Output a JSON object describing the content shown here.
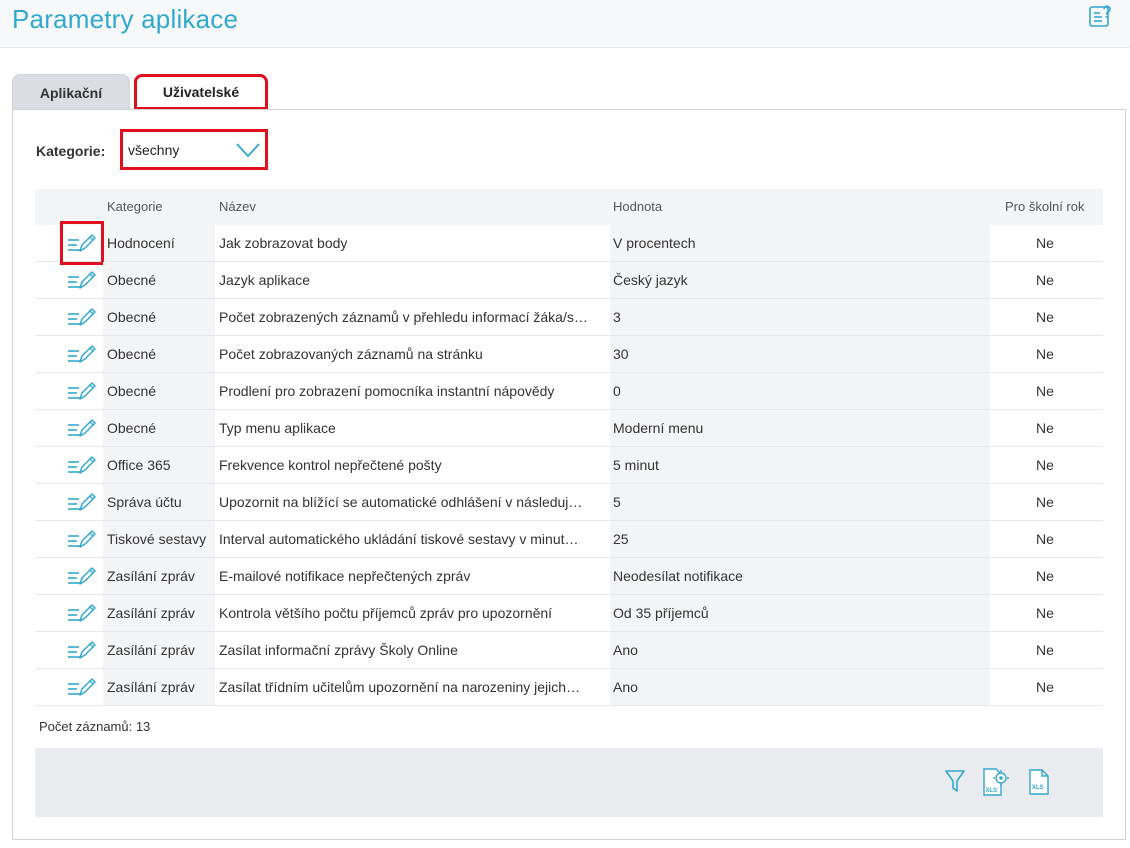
{
  "page": {
    "title": "Parametry aplikace"
  },
  "tabs": [
    {
      "label": "Aplikační"
    },
    {
      "label": "Uživatelské"
    }
  ],
  "filter": {
    "label": "Kategorie:",
    "value": "všechny"
  },
  "table": {
    "columns": [
      "Kategorie",
      "Název",
      "Hodnota",
      "Pro školní rok"
    ],
    "rows": [
      {
        "category": "Hodnocení",
        "name": "Jak zobrazovat body",
        "value": "V procentech",
        "school_year": "Ne"
      },
      {
        "category": "Obecné",
        "name": "Jazyk aplikace",
        "value": "Český jazyk",
        "school_year": "Ne"
      },
      {
        "category": "Obecné",
        "name": "Počet zobrazených záznamů v přehledu informací žáka/s…",
        "value": "3",
        "school_year": "Ne"
      },
      {
        "category": "Obecné",
        "name": "Počet zobrazovaných záznamů na stránku",
        "value": "30",
        "school_year": "Ne"
      },
      {
        "category": "Obecné",
        "name": "Prodlení pro zobrazení pomocníka instantní nápovědy",
        "value": "0",
        "school_year": "Ne"
      },
      {
        "category": "Obecné",
        "name": "Typ menu aplikace",
        "value": "Moderní menu",
        "school_year": "Ne"
      },
      {
        "category": "Office 365",
        "name": "Frekvence kontrol nepřečtené pošty",
        "value": "5 minut",
        "school_year": "Ne"
      },
      {
        "category": "Správa účtu",
        "name": "Upozornit na blížící se automatické odhlášení v následuj…",
        "value": "5",
        "school_year": "Ne"
      },
      {
        "category": "Tiskové sestavy",
        "name": "Interval automatického ukládání tiskové sestavy v minut…",
        "value": "25",
        "school_year": "Ne"
      },
      {
        "category": "Zasílání zpráv",
        "name": "E-mailové notifikace nepřečtených zpráv",
        "value": "Neodesílat notifikace",
        "school_year": "Ne"
      },
      {
        "category": "Zasílání zpráv",
        "name": "Kontrola většího počtu příjemců zpráv pro upozornění",
        "value": "Od 35 příjemců",
        "school_year": "Ne"
      },
      {
        "category": "Zasílání zpráv",
        "name": "Zasílat informační zprávy Školy Online",
        "value": "Ano",
        "school_year": "Ne"
      },
      {
        "category": "Zasílání zpráv",
        "name": "Zasílat třídním učitelům upozornění na narozeniny jejich…",
        "value": "Ano",
        "school_year": "Ne"
      }
    ]
  },
  "record_count": "Počet záznamů: 13",
  "footer_icons": [
    {
      "icon": "filter-icon"
    },
    {
      "icon": "xls-settings-icon",
      "text": "XLS"
    },
    {
      "icon": "xls-export-icon",
      "text": "XLS"
    }
  ],
  "colors": {
    "accent": "#32a8cf",
    "highlight": "#e0101e"
  }
}
